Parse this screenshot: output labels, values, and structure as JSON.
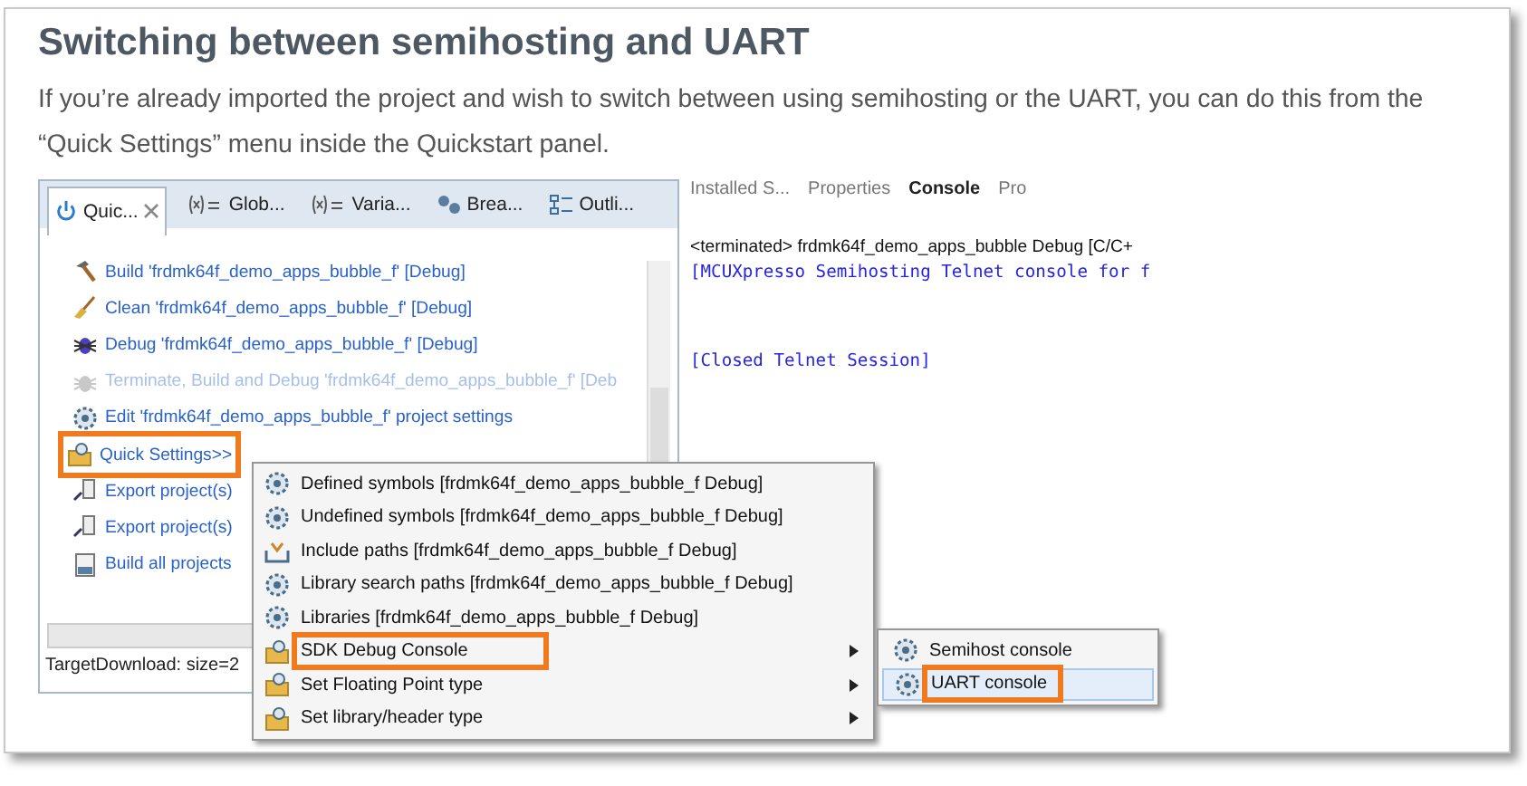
{
  "heading": "Switching between semihosting and UART",
  "paragraph": "If you’re already imported the project and wish to switch between using semihosting or the UART, you can do this from the “Quick Settings” menu inside the Quickstart panel.",
  "screenshot": {
    "left_panel": {
      "tabs": [
        {
          "label": "Quic...",
          "kind": "power",
          "selected": true
        },
        {
          "label": "Glob...",
          "kind": "xvar",
          "selected": false
        },
        {
          "label": "Varia...",
          "kind": "xvar",
          "selected": false
        },
        {
          "label": "Brea...",
          "kind": "breakpoint",
          "selected": false
        },
        {
          "label": "Outli...",
          "kind": "outline",
          "selected": false
        }
      ],
      "actions": [
        {
          "label": "Build 'frdmk64f_demo_apps_bubble_f' [Debug]",
          "kind": "hammer",
          "disabled": false,
          "highlighted": false
        },
        {
          "label": "Clean 'frdmk64f_demo_apps_bubble_f' [Debug]",
          "kind": "broom",
          "disabled": false,
          "highlighted": false
        },
        {
          "label": "Debug 'frdmk64f_demo_apps_bubble_f' [Debug]",
          "kind": "bug",
          "disabled": false,
          "highlighted": false
        },
        {
          "label": "Terminate, Build and Debug 'frdmk64f_demo_apps_bubble_f' [Deb",
          "kind": "bug",
          "disabled": true,
          "highlighted": false
        },
        {
          "label": "Edit 'frdmk64f_demo_apps_bubble_f' project settings",
          "kind": "gear",
          "disabled": false,
          "highlighted": false
        },
        {
          "label": "Quick Settings>>",
          "kind": "folder",
          "disabled": false,
          "highlighted": true
        },
        {
          "label": "Export project(s)",
          "kind": "export",
          "disabled": false,
          "highlighted": false
        },
        {
          "label": "Export project(s)",
          "kind": "export",
          "disabled": false,
          "highlighted": false
        },
        {
          "label": "Build all projects",
          "kind": "file",
          "disabled": false,
          "highlighted": false
        }
      ],
      "status": "TargetDownload: size=2"
    },
    "console": {
      "tabs": [
        {
          "label": "Installed S...",
          "selected": false
        },
        {
          "label": "Properties",
          "selected": false
        },
        {
          "label": "Console",
          "selected": true
        },
        {
          "label": "Pro",
          "selected": false
        }
      ],
      "header": "<terminated> frdmk64f_demo_apps_bubble Debug [C/C+",
      "lines": [
        "[MCUXpresso Semihosting Telnet console for f",
        "[Closed Telnet Session]"
      ]
    },
    "context_menu": [
      {
        "label": "Defined symbols [frdmk64f_demo_apps_bubble_f Debug]",
        "kind": "gear",
        "has_submenu": false,
        "highlighted": false
      },
      {
        "label": "Undefined symbols [frdmk64f_demo_apps_bubble_f Debug]",
        "kind": "gear",
        "has_submenu": false,
        "highlighted": false
      },
      {
        "label": "Include paths [frdmk64f_demo_apps_bubble_f Debug]",
        "kind": "include",
        "has_submenu": false,
        "highlighted": false
      },
      {
        "label": "Library search paths [frdmk64f_demo_apps_bubble_f Debug]",
        "kind": "gear",
        "has_submenu": false,
        "highlighted": false
      },
      {
        "label": "Libraries [frdmk64f_demo_apps_bubble_f Debug]",
        "kind": "gear",
        "has_submenu": false,
        "highlighted": false
      },
      {
        "label": "SDK Debug Console",
        "kind": "folder",
        "has_submenu": true,
        "highlighted": true
      },
      {
        "label": "Set Floating Point type",
        "kind": "folder",
        "has_submenu": true,
        "highlighted": false
      },
      {
        "label": "Set library/header type",
        "kind": "folder",
        "has_submenu": true,
        "highlighted": false
      }
    ],
    "submenu": [
      {
        "label": "Semihost console",
        "kind": "gear",
        "selected": false,
        "highlighted": false
      },
      {
        "label": "UART console",
        "kind": "gear",
        "selected": true,
        "highlighted": true
      }
    ]
  }
}
